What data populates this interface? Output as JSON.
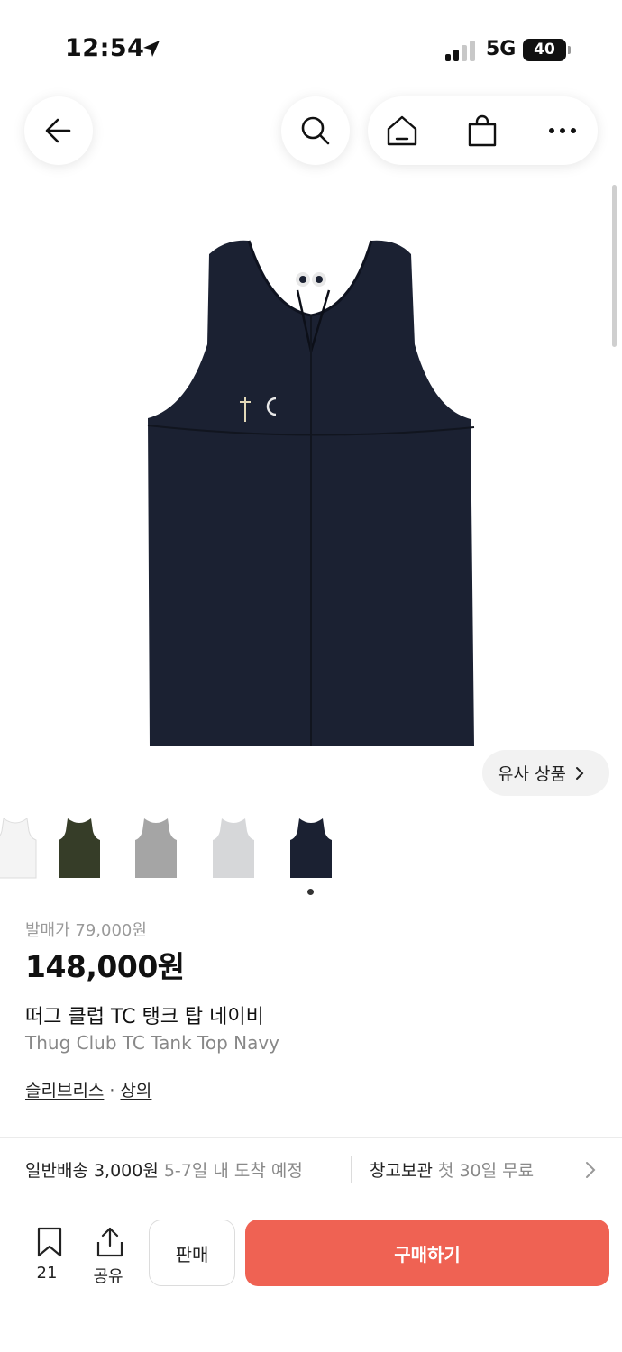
{
  "status_bar": {
    "time": "12:54",
    "network": "5G",
    "battery": "40"
  },
  "nav": {
    "back_icon": "arrow-left-icon",
    "search_icon": "search-icon",
    "home_icon": "home-icon",
    "bag_icon": "shopping-bag-icon",
    "more_icon": "more-horizontal-icon"
  },
  "product_image": {
    "icon": "navy-tank-top-image",
    "color": "#1b2132"
  },
  "similar": {
    "label": "유사 상품"
  },
  "thumbnails": [
    {
      "icon": "white-tank-thumbnail",
      "color": "#f4f4f4"
    },
    {
      "icon": "olive-tank-thumbnail",
      "color": "#363d28"
    },
    {
      "icon": "gray-tank-thumbnail",
      "color": "#a5a5a5"
    },
    {
      "icon": "light-gray-tank-thumbnail",
      "color": "#d6d7d9"
    },
    {
      "icon": "navy-tank-thumbnail",
      "color": "#1b2132"
    }
  ],
  "price": {
    "release_label": "발매가 79,000원",
    "current": "148,000원"
  },
  "title": {
    "korean": "떠그 클럽 TC 탱크 탑 네이비",
    "english": "Thug Club TC Tank Top Navy"
  },
  "breadcrumb": {
    "brand": "슬리브리스",
    "separator": "·",
    "category": "상의"
  },
  "shipping": {
    "normal_label": "일반배송 3,000원",
    "normal_eta": "5-7일 내 도착 예정",
    "warehouse_label": "창고보관",
    "warehouse_note": "첫 30일 무료"
  },
  "bottom_bar": {
    "bookmark_count": "21",
    "share_label": "공유",
    "sell_label": "판매",
    "buy_label": "구매하기",
    "buy_color": "#ef6253"
  }
}
